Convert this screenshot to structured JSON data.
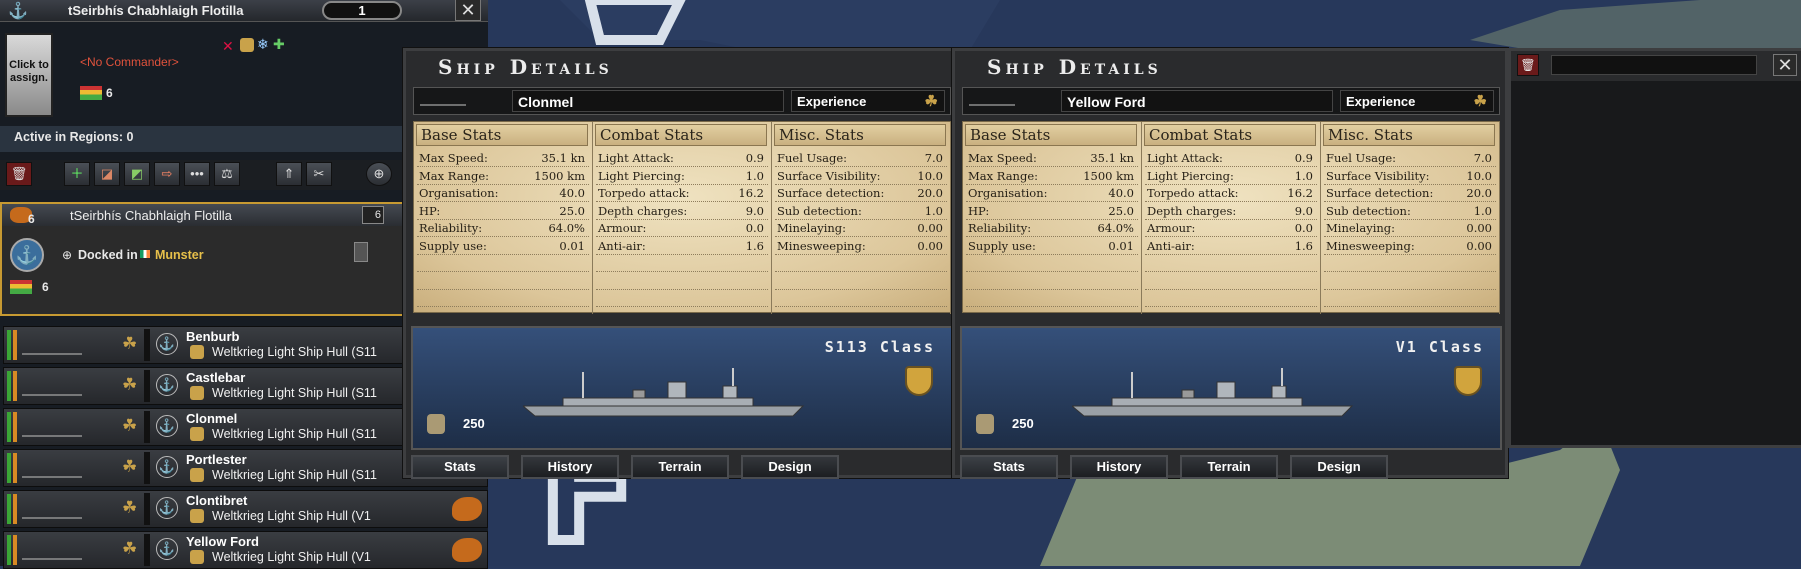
{
  "fleet": {
    "name": "tSeirbhís Chabhlaigh Flotilla",
    "count": "1",
    "close": "✕",
    "commander_button": "Click to assign.",
    "no_commander": "<No Commander>",
    "mini_count": "6",
    "active_regions": "Active in Regions: 0"
  },
  "taskforce": {
    "count": "6",
    "name": "tSeirbhís Chabhlaigh Flotilla",
    "count_right": "6",
    "docked_prefix": "Docked in",
    "docked_location": "Munster",
    "strength": "6"
  },
  "ships": [
    {
      "name": "Benburb",
      "hull": "Weltkrieg Light Ship Hull (S11"
    },
    {
      "name": "Castlebar",
      "hull": "Weltkrieg Light Ship Hull (S11"
    },
    {
      "name": "Clonmel",
      "hull": "Weltkrieg Light Ship Hull (S11"
    },
    {
      "name": "Portlester",
      "hull": "Weltkrieg Light Ship Hull (S11"
    },
    {
      "name": "Clontibret",
      "hull": "Weltkrieg Light Ship Hull (V1"
    },
    {
      "name": "Yellow Ford",
      "hull": "Weltkrieg Light Ship Hull (V1"
    }
  ],
  "details": [
    {
      "title": "Ship Details",
      "ship_name": "Clonmel",
      "experience": "Experience",
      "class": "S113 Class",
      "crew": "250",
      "headers": [
        "Base Stats",
        "Combat Stats",
        "Misc. Stats"
      ],
      "base": [
        [
          "Max Speed:",
          "35.1 kn"
        ],
        [
          "Max Range:",
          "1500 km"
        ],
        [
          "Organisation:",
          "40.0"
        ],
        [
          "HP:",
          "25.0"
        ],
        [
          "Reliability:",
          "64.0%"
        ],
        [
          "Supply use:",
          "0.01"
        ]
      ],
      "combat": [
        [
          "Light Attack:",
          "0.9"
        ],
        [
          "Light Piercing:",
          "1.0"
        ],
        [
          "Torpedo attack:",
          "16.2"
        ],
        [
          "Depth charges:",
          "9.0"
        ],
        [
          "Armour:",
          "0.0"
        ],
        [
          "Anti-air:",
          "1.6"
        ]
      ],
      "misc": [
        [
          "Fuel Usage:",
          "7.0"
        ],
        [
          "Surface Visibility:",
          "10.0"
        ],
        [
          "Surface detection:",
          "20.0"
        ],
        [
          "Sub detection:",
          "1.0"
        ],
        [
          "Minelaying:",
          "0.00"
        ],
        [
          "Minesweeping:",
          "0.00"
        ]
      ],
      "tabs": [
        "Stats",
        "History",
        "Terrain",
        "Design"
      ]
    },
    {
      "title": "Ship Details",
      "ship_name": "Yellow Ford",
      "experience": "Experience",
      "class": "V1 Class",
      "crew": "250",
      "headers": [
        "Base Stats",
        "Combat Stats",
        "Misc. Stats"
      ],
      "base": [
        [
          "Max Speed:",
          "35.1 kn"
        ],
        [
          "Max Range:",
          "1500 km"
        ],
        [
          "Organisation:",
          "40.0"
        ],
        [
          "HP:",
          "25.0"
        ],
        [
          "Reliability:",
          "64.0%"
        ],
        [
          "Supply use:",
          "0.01"
        ]
      ],
      "combat": [
        [
          "Light Attack:",
          "0.9"
        ],
        [
          "Light Piercing:",
          "1.0"
        ],
        [
          "Torpedo attack:",
          "16.2"
        ],
        [
          "Depth charges:",
          "9.0"
        ],
        [
          "Armour:",
          "0.0"
        ],
        [
          "Anti-air:",
          "1.6"
        ]
      ],
      "misc": [
        [
          "Fuel Usage:",
          "7.0"
        ],
        [
          "Surface Visibility:",
          "10.0"
        ],
        [
          "Surface detection:",
          "20.0"
        ],
        [
          "Sub detection:",
          "1.0"
        ],
        [
          "Minelaying:",
          "0.00"
        ],
        [
          "Minesweeping:",
          "0.00"
        ]
      ],
      "tabs": [
        "Stats",
        "History",
        "Terrain",
        "Design"
      ]
    }
  ],
  "icons": {
    "anchor": "⚓",
    "clover": "☘",
    "trash": "🗑",
    "close": "✕"
  },
  "colors": {
    "ocean": "#28395c",
    "land": "#7a8a78",
    "parchment": "#e6d4a8",
    "accent_gold": "#c79a32",
    "commander_red": "#e0523c"
  }
}
